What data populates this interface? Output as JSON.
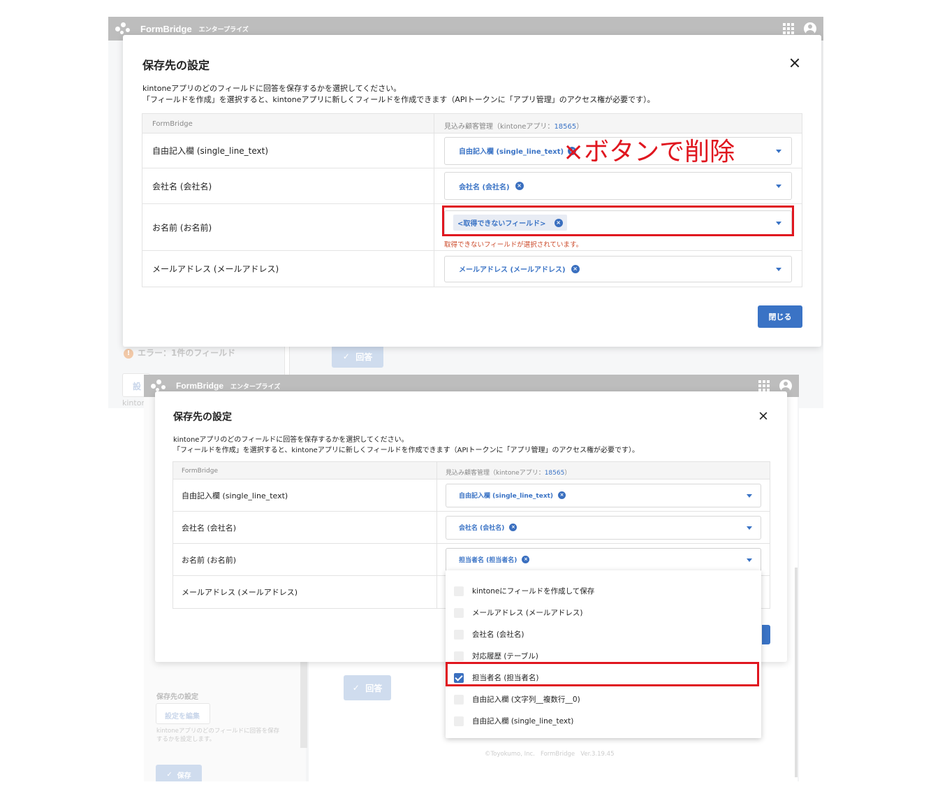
{
  "app": {
    "brand": "FormBridge",
    "edition": "エンタープライズ"
  },
  "colors": {
    "accent": "#3a73c5",
    "annotation_red": "#e0161f",
    "error_text": "#cc4a2a",
    "appbar_gray": "#bdbdbd"
  },
  "icons": [
    "formbridge-logo-icon",
    "apps-grid-icon",
    "user-avatar-icon",
    "close-icon",
    "chip-remove-icon",
    "chevron-down-icon",
    "checkbox-icon",
    "check-icon",
    "warning-icon"
  ],
  "annotation": "×ボタンで削除",
  "background": {
    "error_summary": "エラー：1件のフィールド",
    "answer_button": "回答",
    "save_dest_heading": "保存先の設定",
    "edit_settings_button": "設定を編集",
    "save_dest_help": "kintoneアプリのどのフィールドに回答を保存するかを設定します。",
    "save_button": "保存",
    "footer_company": "©Toyokumo, Inc.",
    "footer_product": "FormBridge",
    "footer_version": "Ver.3.19.45",
    "partial_settings": "設",
    "partial_kintone": "kinton"
  },
  "dialog1": {
    "title": "保存先の設定",
    "desc_line1": "kintoneアプリのどのフィールドに回答を保存するかを選択してください。",
    "desc_line2": "「フィールドを作成」を選択すると、kintoneアプリに新しくフィールドを作成できます（APIトークンに「アプリ管理」のアクセス権が必要です）。",
    "col_formbridge": "FormBridge",
    "col_kintone_prefix": "見込み顧客管理（kintoneアプリ：",
    "col_kintone_app_id": "18565",
    "col_kintone_suffix": "）",
    "rows": [
      {
        "label": "自由記入欄 (single_line_text)",
        "selected": "自由記入欄 (single_line_text)"
      },
      {
        "label": "会社名 (会社名)",
        "selected": "会社名 (会社名)"
      },
      {
        "label": "お名前 (お名前)",
        "selected": "<取得できないフィールド>",
        "error": "取得できないフィールドが選択されています。"
      },
      {
        "label": "メールアドレス (メールアドレス)",
        "selected": "メールアドレス (メールアドレス)"
      }
    ],
    "close_button": "閉じる"
  },
  "dialog2": {
    "title": "保存先の設定",
    "desc_line1": "kintoneアプリのどのフィールドに回答を保存するかを選択してください。",
    "desc_line2": "「フィールドを作成」を選択すると、kintoneアプリに新しくフィールドを作成できます（APIトークンに「アプリ管理」のアクセス権が必要です）。",
    "col_formbridge": "FormBridge",
    "col_kintone_prefix": "見込み顧客管理（kintoneアプリ：",
    "col_kintone_app_id": "18565",
    "col_kintone_suffix": "）",
    "rows": [
      {
        "label": "自由記入欄 (single_line_text)",
        "selected": "自由記入欄 (single_line_text)"
      },
      {
        "label": "会社名 (会社名)",
        "selected": "会社名 (会社名)"
      },
      {
        "label": "お名前 (お名前)",
        "selected": "担当者名 (担当者名)"
      },
      {
        "label": "メールアドレス (メールアドレス)"
      }
    ],
    "dropdown_options": [
      {
        "label": "kintoneにフィールドを作成して保存",
        "checked": false
      },
      {
        "label": "メールアドレス (メールアドレス)",
        "checked": false
      },
      {
        "label": "会社名 (会社名)",
        "checked": false
      },
      {
        "label": "対応履歴 (テーブル)",
        "checked": false
      },
      {
        "label": "担当者名 (担当者名)",
        "checked": true
      },
      {
        "label": "自由記入欄 (文字列__複数行__0)",
        "checked": false
      },
      {
        "label": "自由記入欄 (single_line_text)",
        "checked": false
      }
    ]
  }
}
